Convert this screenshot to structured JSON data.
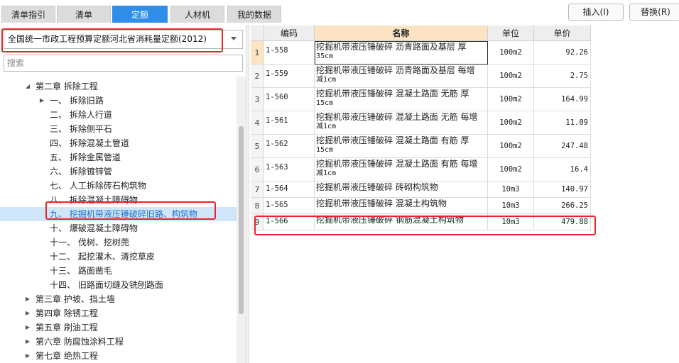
{
  "tabs": [
    {
      "label": "清单指引",
      "active": false
    },
    {
      "label": "清单",
      "active": false
    },
    {
      "label": "定额",
      "active": true
    },
    {
      "label": "人材机",
      "active": false
    },
    {
      "label": "我的数据",
      "active": false
    }
  ],
  "toolbar": {
    "insert_label": "插入(I)",
    "replace_label": "替换(R)"
  },
  "left": {
    "selected_quota": "全国统一市政工程预算定额河北省消耗量定额(2012)",
    "search_placeholder": "搜索",
    "tree": [
      {
        "label": "第二章 拆除工程",
        "level": 0,
        "toggle": "expanded"
      },
      {
        "label": "一、 拆除旧路",
        "level": 1,
        "toggle": "collapsed"
      },
      {
        "label": "二、 拆除人行道",
        "level": 1,
        "toggle": "none"
      },
      {
        "label": "三、 拆除侧平石",
        "level": 1,
        "toggle": "none"
      },
      {
        "label": "四、 拆除混凝土管道",
        "level": 1,
        "toggle": "none"
      },
      {
        "label": "五、 拆除金属管道",
        "level": 1,
        "toggle": "none"
      },
      {
        "label": "六、 拆除镀锌管",
        "level": 1,
        "toggle": "none"
      },
      {
        "label": "七、 人工拆除砖石构筑物",
        "level": 1,
        "toggle": "none"
      },
      {
        "label": "八、 拆除混凝土障碍物",
        "level": 1,
        "toggle": "none"
      },
      {
        "label": "九、 挖掘机带液压锤破碎旧路、构筑物",
        "level": 1,
        "toggle": "none",
        "selected": true
      },
      {
        "label": "十、 爆破混凝土障碍物",
        "level": 1,
        "toggle": "none"
      },
      {
        "label": "十一、 伐树、挖树蔸",
        "level": 1,
        "toggle": "none"
      },
      {
        "label": "十二、 起挖灌木、清挖草皮",
        "level": 1,
        "toggle": "none"
      },
      {
        "label": "十三、 路面凿毛",
        "level": 1,
        "toggle": "none"
      },
      {
        "label": "十四、 旧路面切缝及铣刨路面",
        "level": 1,
        "toggle": "none"
      },
      {
        "label": "第三章 护坡、挡土墙",
        "level": 0,
        "toggle": "collapsed"
      },
      {
        "label": "第四章 除锈工程",
        "level": 0,
        "toggle": "collapsed"
      },
      {
        "label": "第五章 刷油工程",
        "level": 0,
        "toggle": "collapsed"
      },
      {
        "label": "第六章 防腐蚀涂料工程",
        "level": 0,
        "toggle": "collapsed"
      },
      {
        "label": "第七章 绝热工程",
        "level": 0,
        "toggle": "collapsed"
      }
    ]
  },
  "grid": {
    "headers": [
      "",
      "编码",
      "名称",
      "单位",
      "单价"
    ],
    "rows": [
      {
        "idx": "1",
        "code": "1-558",
        "name": "挖掘机带液压锤破碎 沥青路面及基层 厚",
        "name2": "35cm",
        "unit": "100m2",
        "price": "92.26"
      },
      {
        "idx": "2",
        "code": "1-559",
        "name": "挖掘机带液压锤破碎 沥青路面及基层 每增",
        "name2": "减1cm",
        "unit": "100m2",
        "price": "2.75"
      },
      {
        "idx": "3",
        "code": "1-560",
        "name": "挖掘机带液压锤破碎 混凝土路面 无筋 厚",
        "name2": "15cm",
        "unit": "100m2",
        "price": "164.99"
      },
      {
        "idx": "4",
        "code": "1-561",
        "name": "挖掘机带液压锤破碎 混凝土路面 无筋 每增",
        "name2": "减1cm",
        "unit": "100m2",
        "price": "11.09"
      },
      {
        "idx": "5",
        "code": "1-562",
        "name": "挖掘机带液压锤破碎 混凝土路面 有筋 厚",
        "name2": "15cm",
        "unit": "100m2",
        "price": "247.48"
      },
      {
        "idx": "6",
        "code": "1-563",
        "name": "挖掘机带液压锤破碎 混凝土路面 有筋 每增",
        "name2": "减1cm",
        "unit": "100m2",
        "price": "16.4"
      },
      {
        "idx": "7",
        "code": "1-564",
        "name": "挖掘机带液压锤破碎 砖砌构筑物",
        "name2": "",
        "unit": "10m3",
        "price": "140.97"
      },
      {
        "idx": "8",
        "code": "1-565",
        "name": "挖掘机带液压锤破碎 混凝土构筑物",
        "name2": "",
        "unit": "10m3",
        "price": "266.25"
      },
      {
        "idx": "9",
        "code": "1-566",
        "name": "挖掘机带液压锤破碎 钢筋混凝土构筑物",
        "name2": "",
        "unit": "10m3",
        "price": "479.88"
      }
    ]
  },
  "colors": {
    "accent": "#2e8ee8",
    "highlight": "#e5262d",
    "selected_row": "#cfe6f9",
    "header_selected": "#fbe3c4"
  }
}
